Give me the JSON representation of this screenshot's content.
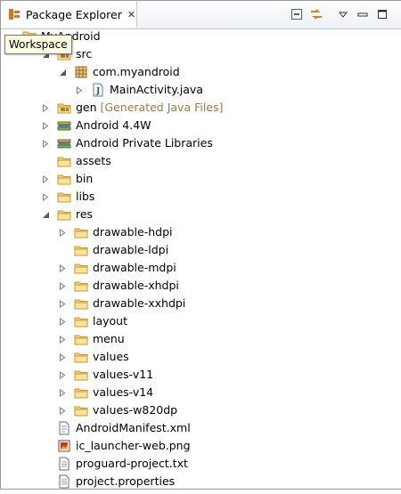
{
  "view": {
    "tab_label": "Package Explorer",
    "tab_close": "✕",
    "tooltip": "Workspace",
    "toolbar": [
      "collapse-all",
      "link-with-editor",
      "view-menu",
      "minimize",
      "maximize"
    ]
  },
  "tree": [
    {
      "label": "MyAndroid",
      "icon": "project",
      "depth": 0,
      "twisty": "expanded"
    },
    {
      "label": "src",
      "icon": "source-folder",
      "depth": 1,
      "twisty": "expanded"
    },
    {
      "label": "com.myandroid",
      "icon": "package",
      "depth": 2,
      "twisty": "expanded"
    },
    {
      "label": "MainActivity.java",
      "icon": "java-file",
      "depth": 3,
      "twisty": "collapsed"
    },
    {
      "label": "gen",
      "decoration": "[Generated Java Files]",
      "icon": "source-folder",
      "depth": 1,
      "twisty": "collapsed"
    },
    {
      "label": "Android 4.4W",
      "icon": "library",
      "depth": 1,
      "twisty": "collapsed"
    },
    {
      "label": "Android Private Libraries",
      "icon": "library",
      "depth": 1,
      "twisty": "collapsed"
    },
    {
      "label": "assets",
      "icon": "folder",
      "depth": 1,
      "twisty": "none"
    },
    {
      "label": "bin",
      "icon": "folder",
      "depth": 1,
      "twisty": "collapsed"
    },
    {
      "label": "libs",
      "icon": "folder",
      "depth": 1,
      "twisty": "collapsed"
    },
    {
      "label": "res",
      "icon": "folder",
      "depth": 1,
      "twisty": "expanded"
    },
    {
      "label": "drawable-hdpi",
      "icon": "folder",
      "depth": 2,
      "twisty": "collapsed"
    },
    {
      "label": "drawable-ldpi",
      "icon": "folder",
      "depth": 2,
      "twisty": "none"
    },
    {
      "label": "drawable-mdpi",
      "icon": "folder",
      "depth": 2,
      "twisty": "collapsed"
    },
    {
      "label": "drawable-xhdpi",
      "icon": "folder",
      "depth": 2,
      "twisty": "collapsed"
    },
    {
      "label": "drawable-xxhdpi",
      "icon": "folder",
      "depth": 2,
      "twisty": "collapsed"
    },
    {
      "label": "layout",
      "icon": "folder",
      "depth": 2,
      "twisty": "collapsed"
    },
    {
      "label": "menu",
      "icon": "folder",
      "depth": 2,
      "twisty": "collapsed"
    },
    {
      "label": "values",
      "icon": "folder",
      "depth": 2,
      "twisty": "collapsed"
    },
    {
      "label": "values-v11",
      "icon": "folder",
      "depth": 2,
      "twisty": "collapsed"
    },
    {
      "label": "values-v14",
      "icon": "folder",
      "depth": 2,
      "twisty": "collapsed"
    },
    {
      "label": "values-w820dp",
      "icon": "folder",
      "depth": 2,
      "twisty": "collapsed"
    },
    {
      "label": "AndroidManifest.xml",
      "icon": "xml-file",
      "depth": 1,
      "twisty": "none"
    },
    {
      "label": "ic_launcher-web.png",
      "icon": "image-file",
      "depth": 1,
      "twisty": "none"
    },
    {
      "label": "proguard-project.txt",
      "icon": "text-file",
      "depth": 1,
      "twisty": "none"
    },
    {
      "label": "project.properties",
      "icon": "text-file",
      "depth": 1,
      "twisty": "none"
    }
  ]
}
